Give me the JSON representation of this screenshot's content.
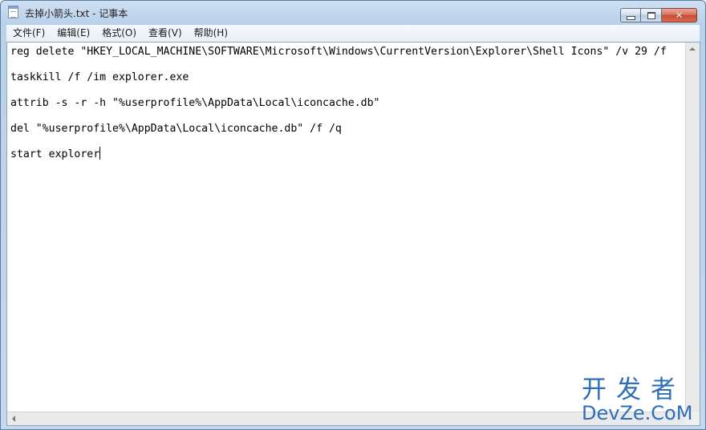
{
  "window": {
    "title": "去掉小箭头.txt - 记事本",
    "icon": "notepad-icon",
    "buttons": {
      "minimize": "minimize-icon",
      "maximize": "maximize-icon",
      "close": "close-icon",
      "close_glyph": "✕"
    }
  },
  "menu": {
    "items": [
      {
        "label": "文件(F)"
      },
      {
        "label": "编辑(E)"
      },
      {
        "label": "格式(O)"
      },
      {
        "label": "查看(V)"
      },
      {
        "label": "帮助(H)"
      }
    ]
  },
  "editor": {
    "lines": [
      "reg delete \"HKEY_LOCAL_MACHINE\\SOFTWARE\\Microsoft\\Windows\\CurrentVersion\\Explorer\\Shell Icons\" /v 29 /f",
      "",
      "taskkill /f /im explorer.exe",
      "",
      "attrib -s -r -h \"%userprofile%\\AppData\\Local\\iconcache.db\"",
      "",
      "del \"%userprofile%\\AppData\\Local\\iconcache.db\" /f /q",
      "",
      "start explorer"
    ]
  },
  "watermark": {
    "cn": "开发者",
    "en": "DevZe.CoM"
  },
  "colors": {
    "watermark": "#2e6fb8",
    "close_button": "#c84b31"
  }
}
